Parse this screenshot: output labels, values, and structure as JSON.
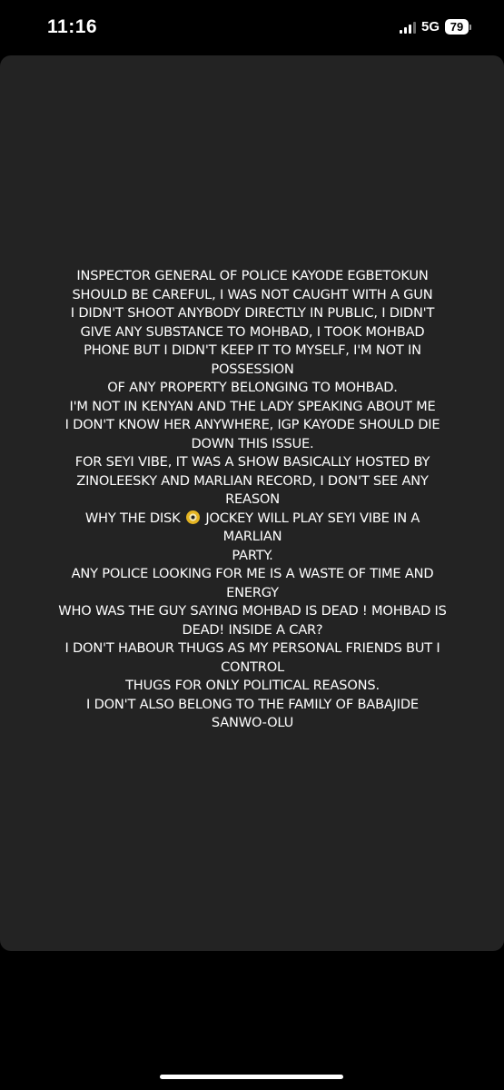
{
  "status_bar": {
    "time": "11:16",
    "network": "5G",
    "battery": "79",
    "signal_icon": "cellular-signal-icon",
    "battery_icon": "battery-icon"
  },
  "story": {
    "lines": [
      "INSPECTOR GENERAL OF POLICE KAYODE EGBETOKUN",
      "SHOULD BE CAREFUL, I WAS NOT CAUGHT WITH A GUN",
      "I DIDN'T SHOOT ANYBODY DIRECTLY IN PUBLIC, I DIDN'T",
      "GIVE ANY SUBSTANCE TO MOHBAD, I TOOK MOHBAD",
      "PHONE BUT I DIDN'T KEEP IT TO MYSELF, I'M NOT IN",
      "POSSESSION",
      "OF ANY PROPERTY BELONGING TO MOHBAD.",
      "I'M NOT IN KENYAN AND THE LADY SPEAKING ABOUT ME",
      "I DON'T KNOW HER ANYWHERE, IGP KAYODE SHOULD DIE",
      "DOWN THIS ISSUE.",
      "FOR SEYI VIBE, IT WAS A SHOW BASICALLY HOSTED BY",
      "ZINOLEESKY AND MARLIAN RECORD, I DON'T SEE ANY",
      "REASON",
      "WHY THE DISK",
      "JOCKEY WILL PLAY SEYI VIBE IN A",
      "MARLIAN",
      "PARTY.",
      "ANY POLICE LOOKING FOR ME IS A WASTE OF TIME AND",
      "ENERGY",
      "WHO WAS THE GUY SAYING MOHBAD IS DEAD ! MOHBAD IS",
      "DEAD! INSIDE A CAR?",
      "I DON'T HABOUR THUGS AS MY PERSONAL FRIENDS BUT I",
      "CONTROL",
      "THUGS FOR ONLY POLITICAL REASONS.",
      "I DON'T ALSO BELONG TO THE FAMILY OF  BABAJIDE",
      "SANWO-OLU"
    ],
    "disc_icon": "optical-disc-emoji-icon"
  }
}
